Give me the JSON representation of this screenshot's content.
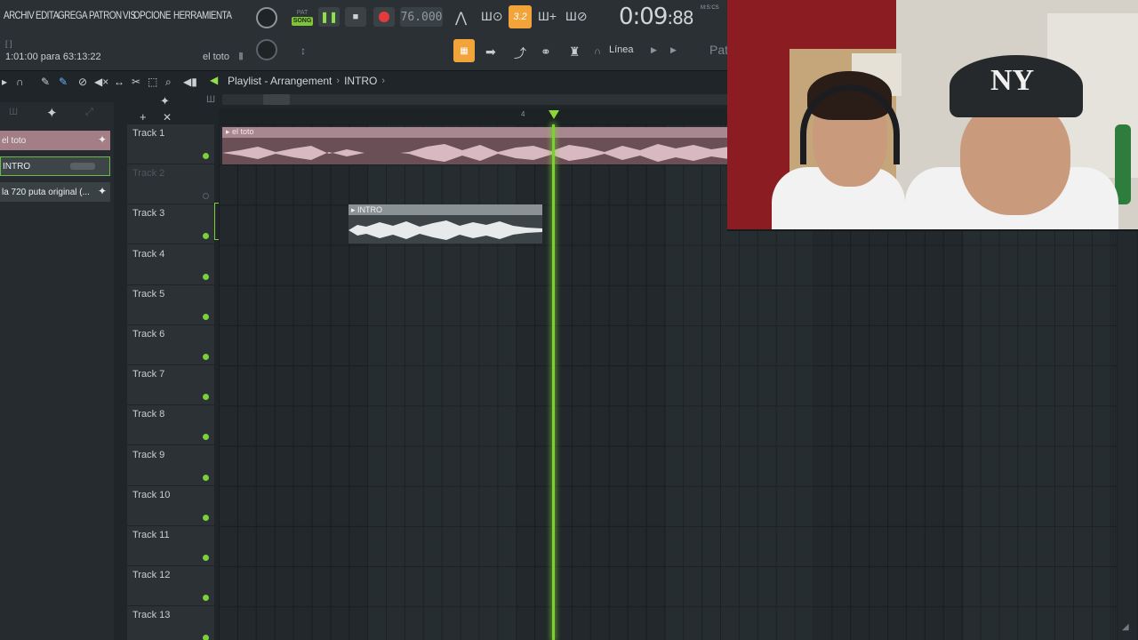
{
  "menu": [
    "ARCHIV",
    "EDITA",
    "GREGA",
    "PATRON",
    "VIS",
    "OPCIONE",
    "HERRAMIENTA"
  ],
  "hint_text": "1:01:00 para 63:13:22",
  "hint_bracket": "[ ]",
  "hint_right": "el toto",
  "transport": {
    "pat_label": "PAT",
    "song_label": "SONG",
    "play_glyph": "❚❚",
    "stop_glyph": "■",
    "tempo": "76.000",
    "pattern_number": "3.2",
    "time_main": "0:09",
    "time_sub": ":88",
    "time_format": "M:S:CS"
  },
  "snap_mode": "Línea",
  "pattern_partial": "Patr",
  "playlist": {
    "title": "Playlist - Arrangement",
    "pattern": "INTRO"
  },
  "browser_clips": [
    {
      "label": "el toto",
      "plus": "+"
    },
    {
      "label": "INTRO",
      "plus": ""
    },
    {
      "label": "la 720 puta original (...",
      "plus": "+"
    }
  ],
  "tracks": [
    {
      "label": "Track 1",
      "led": true
    },
    {
      "label": "Track 2",
      "led": false
    },
    {
      "label": "Track 3",
      "led": true
    },
    {
      "label": "Track 4",
      "led": true
    },
    {
      "label": "Track 5",
      "led": true
    },
    {
      "label": "Track 6",
      "led": true
    },
    {
      "label": "Track 7",
      "led": true
    },
    {
      "label": "Track 8",
      "led": true
    },
    {
      "label": "Track 9",
      "led": true
    },
    {
      "label": "Track 10",
      "led": true
    },
    {
      "label": "Track 11",
      "led": true
    },
    {
      "label": "Track 12",
      "led": true
    },
    {
      "label": "Track 13",
      "led": true
    }
  ],
  "arrangement_clips": [
    {
      "name": "el toto",
      "track": 1
    },
    {
      "name": "INTRO",
      "track": 3
    }
  ],
  "ruler_tick": "4",
  "webcam_logo": "NY",
  "colors": {
    "accent_orange": "#f2a43a",
    "playhead_green": "#7ad12f",
    "song_green": "#7fc33a",
    "record_red": "#e23b3b",
    "clip_pink": "#a98790"
  }
}
